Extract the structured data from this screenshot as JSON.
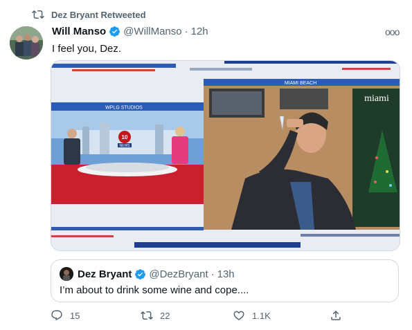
{
  "retweet_banner": {
    "label": "Dez Bryant Retweeted"
  },
  "tweet": {
    "author_name": "Will Manso",
    "handle": "@WillManso",
    "separator": "·",
    "time": "12h",
    "more_label": "ooo",
    "text": "I feel you, Dez."
  },
  "media": {
    "left_panel_label": "WPLG STUDIOS",
    "right_panel_label": "MIAMI BEACH",
    "logo_channel": "10",
    "logo_text": "NEWS",
    "banner_text": "miami"
  },
  "quoted_tweet": {
    "author_name": "Dez Bryant",
    "handle": "@DezBryant",
    "separator": "·",
    "time": "13h",
    "text": "I’m about to drink some wine and cope...."
  },
  "actions": {
    "reply_count": "15",
    "retweet_count": "22",
    "like_count": "1.1K"
  },
  "colors": {
    "verified_blue": "#1d9bf0",
    "secondary_text": "#536471",
    "border": "#cfd9de"
  }
}
